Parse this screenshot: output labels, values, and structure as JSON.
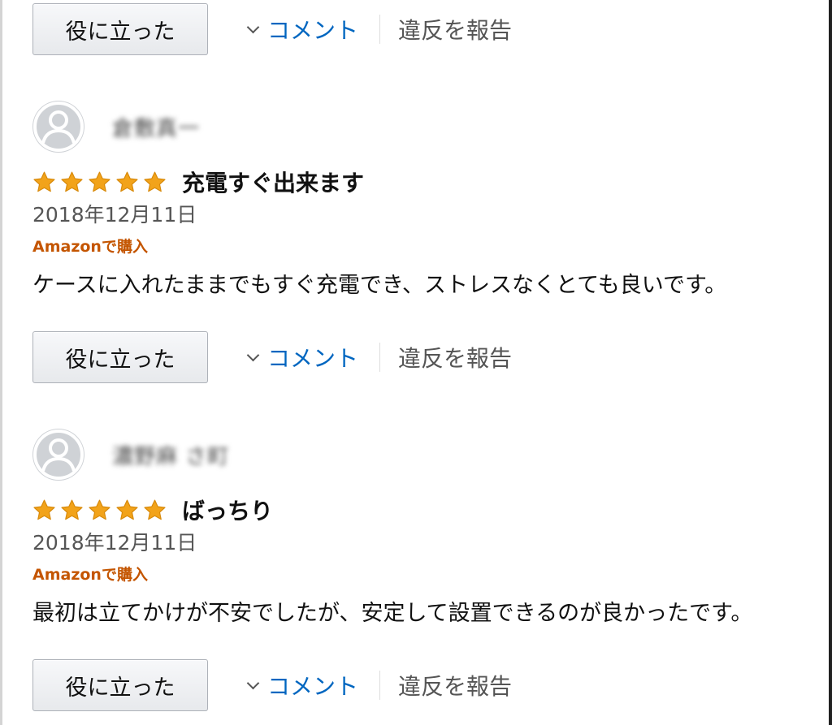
{
  "actions": {
    "helpful_label": "役に立った",
    "comment_label": "コメント",
    "report_label": "違反を報告"
  },
  "reviews": [
    {
      "username": "倉敷真一",
      "rating": 5,
      "rating_max": 5,
      "title": "充電すぐ出来ます",
      "date": "2018年12月11日",
      "verified": "Amazonで購入",
      "body": "ケースに入れたままでもすぐ充電でき、ストレスなくとても良いです。"
    },
    {
      "username": "濃野麻 さ町",
      "rating": 5,
      "rating_max": 5,
      "title": "ばっちり",
      "date": "2018年12月11日",
      "verified": "Amazonで購入",
      "body": "最初は立てかけが不安でしたが、安定して設置できるのが良かったです。"
    }
  ],
  "colors": {
    "star": "#f2a31a",
    "star_stroke": "#d88a0b",
    "verified": "#c45500",
    "link": "#0066c0"
  }
}
